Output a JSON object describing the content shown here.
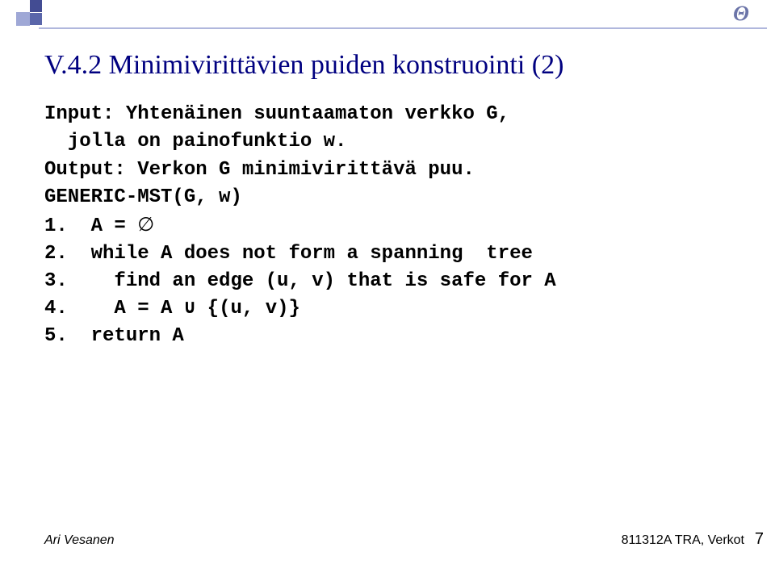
{
  "corner": {
    "theta": "Θ"
  },
  "title": "V.4.2 Minimivirittävien puiden konstruointi (2)",
  "code": {
    "l1": "Input: Yhtenäinen suuntaamaton verkko G,",
    "l2": "  jolla on painofunktio w.",
    "l3": "Output: Verkon G minimivirittävä puu.",
    "l4": "GENERIC-MST(G, w)",
    "l5a": "1.  A = ",
    "l5b": "∅",
    "l6": "2.  while A does not form a spanning  tree",
    "l7": "3.    find an edge (u, v) that is safe for A",
    "l8": "4.    A = A ∪ {(u, v)}",
    "l9": "5.  return A"
  },
  "footer": {
    "left": "Ari Vesanen",
    "right": "811312A TRA, Verkot",
    "page": "7"
  }
}
